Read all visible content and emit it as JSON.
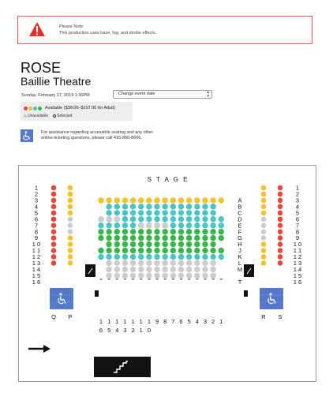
{
  "notice": {
    "title": "Please Note:",
    "text": "This production uses haze, fog, and strobe effects.",
    "icon": "warning-icon",
    "color": "#e03131"
  },
  "event": {
    "title": "ROSE",
    "venue": "Baillie Theatre",
    "date": "Sunday, February 17, 2019 1:30PM",
    "change_date_label": "Change event date"
  },
  "legend": {
    "available": "Available ($38.00–$107.00 for Adult)",
    "unavailable": "Unavailable",
    "selected": "Selected",
    "colors": [
      "#e8493d",
      "#f2c12e",
      "#4cc3c4",
      "#3ab54a"
    ]
  },
  "accessibility": {
    "line1": "For assistance regarding accessible seating and any other",
    "line2": "online ticketing questions, please call 416-866-8666.",
    "icon": "wheelchair-icon"
  },
  "seatmap": {
    "stage_label": "STAGE",
    "row_numbers": [
      "1",
      "2",
      "3",
      "4",
      "5",
      "6",
      "7",
      "8",
      "9",
      "10",
      "11",
      "12",
      "13",
      "14",
      "15",
      "16"
    ],
    "center_rows": [
      "A",
      "B",
      "C",
      "D",
      "E",
      "F",
      "G",
      "H",
      "J",
      "K",
      "L",
      "M",
      "T"
    ],
    "side_column_left": [
      "Q",
      "P"
    ],
    "side_column_right": [
      "R",
      "S"
    ],
    "seat_numbers": [
      "16",
      "15",
      "14",
      "13",
      "12",
      "11",
      "10",
      "9",
      "8",
      "7",
      "6",
      "5",
      "4",
      "3",
      "2",
      "1"
    ],
    "colors": {
      "red": "#e8493d",
      "yellow": "#f2c12e",
      "teal": "#4cc3c4",
      "green": "#3ab54a",
      "grey": "#cccccc",
      "blue": "#5578c9",
      "dark": "#111111"
    },
    "icons": [
      "wheelchair-icon",
      "stairs-icon",
      "arrow-right-icon",
      "exit-icon"
    ]
  }
}
